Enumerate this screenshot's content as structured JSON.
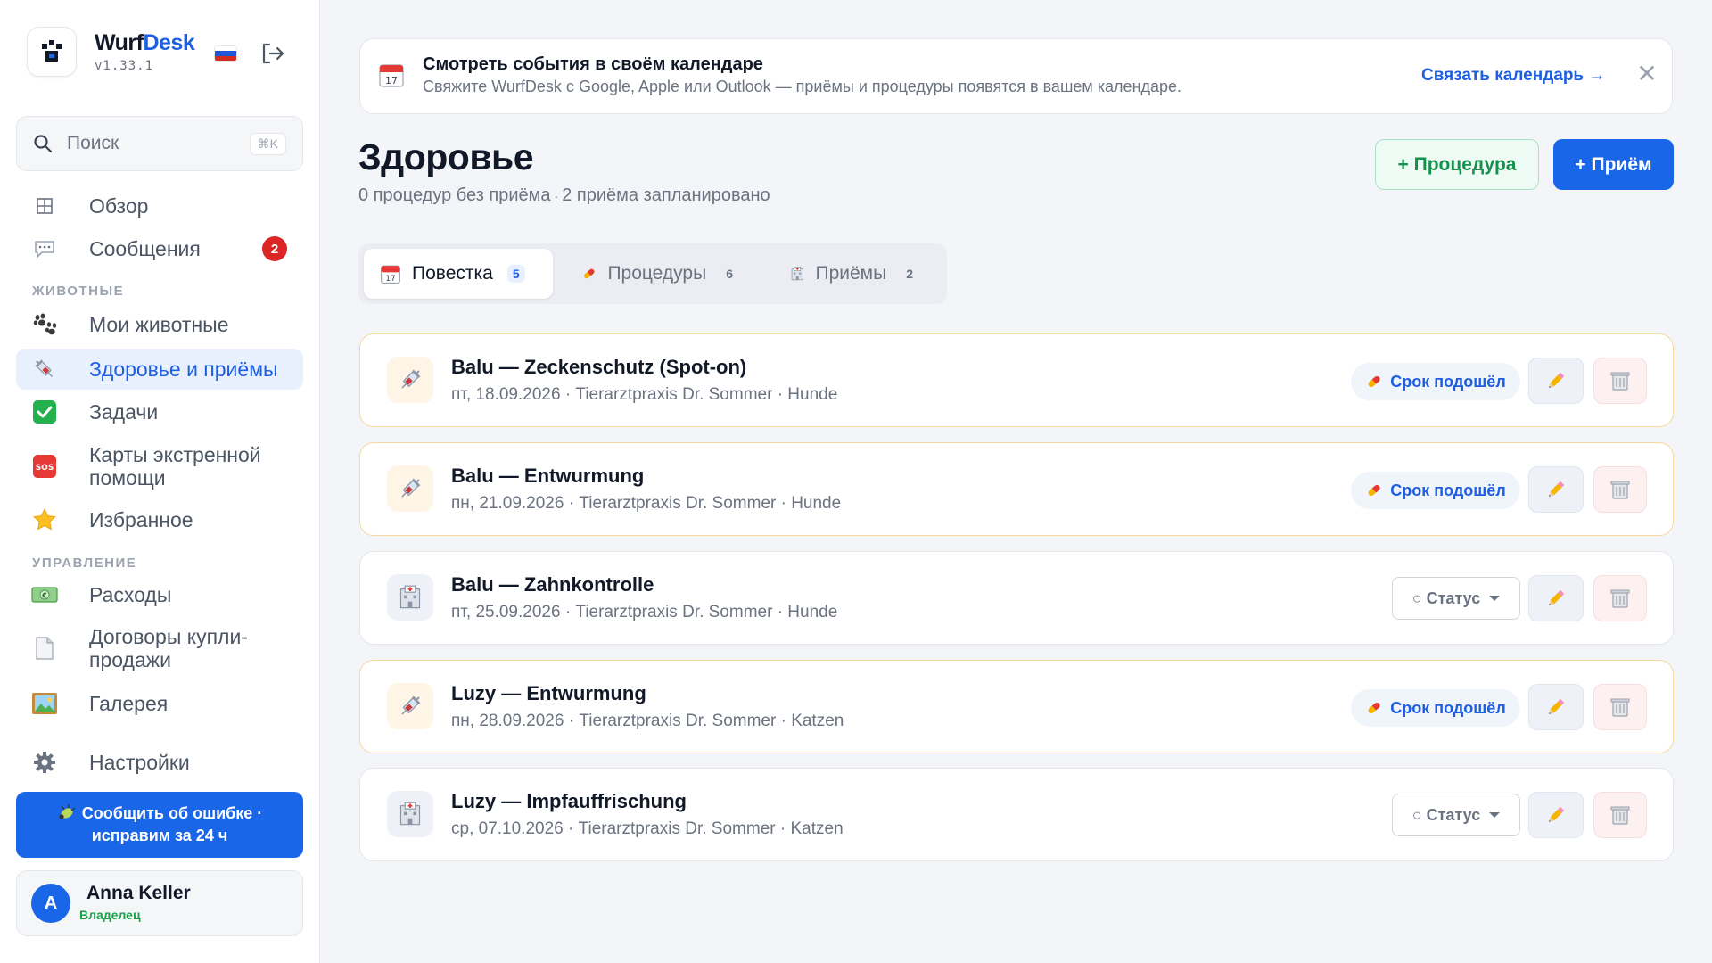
{
  "app": {
    "name_part1": "Wurf",
    "name_part2": "Desk",
    "version": "v1.33.1"
  },
  "search": {
    "placeholder": "Поиск",
    "shortcut": "⌘K"
  },
  "nav": {
    "overview": "Обзор",
    "messages": "Сообщения",
    "messages_badge": "2",
    "section_animals": "ЖИВОТНЫЕ",
    "my_animals": "Мои животные",
    "health": "Здоровье и приёмы",
    "tasks": "Задачи",
    "emergency_line1": "Карты экстренной",
    "emergency_line2": "помощи",
    "favorites": "Избранное",
    "section_management": "УПРАВЛЕНИЕ",
    "expenses": "Расходы",
    "contracts_line1": "Договоры купли-",
    "contracts_line2": "продажи",
    "gallery": "Галерея",
    "settings": "Настройки"
  },
  "report": {
    "line1": "Сообщить об ошибке ·",
    "line2": "исправим за 24 ч"
  },
  "user": {
    "initial": "A",
    "name": "Anna Keller",
    "role": "Владелец"
  },
  "banner": {
    "title": "Смотреть события в своём календаре",
    "subtitle": "Свяжите WurfDesk с Google, Apple или Outlook — приёмы и процедуры появятся в вашем календаре.",
    "link": "Связать календарь →",
    "close": "✕",
    "calendar_day": "17"
  },
  "page": {
    "title": "Здоровье",
    "stat1": "0 процедур без приёма",
    "stat_sep": "·",
    "stat2": "2 приёма запланировано",
    "add_procedure": "+ Процедура",
    "add_appointment": "+ Приём"
  },
  "tabs": [
    {
      "label": "Повестка",
      "count": "5"
    },
    {
      "label": "Процедуры",
      "count": "6"
    },
    {
      "label": "Приёмы",
      "count": "2"
    }
  ],
  "events": [
    {
      "title": "Balu — Zeckenschutz (Spot-on)",
      "subtitle": "пт, 18.09.2026 · Tierarztpraxis Dr. Sommer · Hunde",
      "kind": "procedure",
      "status": "Срок подошёл"
    },
    {
      "title": "Balu — Entwurmung",
      "subtitle": "пн, 21.09.2026 · Tierarztpraxis Dr. Sommer · Hunde",
      "kind": "procedure",
      "status": "Срок подошёл"
    },
    {
      "title": "Balu — Zahnkontrolle",
      "subtitle": "пт, 25.09.2026 · Tierarztpraxis Dr. Sommer · Hunde",
      "kind": "appointment",
      "status": "○ Статус"
    },
    {
      "title": "Luzy — Entwurmung",
      "subtitle": "пн, 28.09.2026 · Tierarztpraxis Dr. Sommer · Katzen",
      "kind": "procedure",
      "status": "Срок подошёл"
    },
    {
      "title": "Luzy — Impfauffrischung",
      "subtitle": "ср, 07.10.2026 · Tierarztpraxis Dr. Sommer · Katzen",
      "kind": "appointment",
      "status": "○ Статус"
    }
  ],
  "colors": {
    "accent": "#1a66e8",
    "success": "#17904e",
    "danger": "#dc2626",
    "due_border": "#f7d9a0"
  },
  "icons": {
    "procedure": "syringe-icon",
    "appointment": "hospital-icon",
    "due": "pill-icon",
    "edit": "pencil-icon",
    "delete": "trash-icon"
  }
}
